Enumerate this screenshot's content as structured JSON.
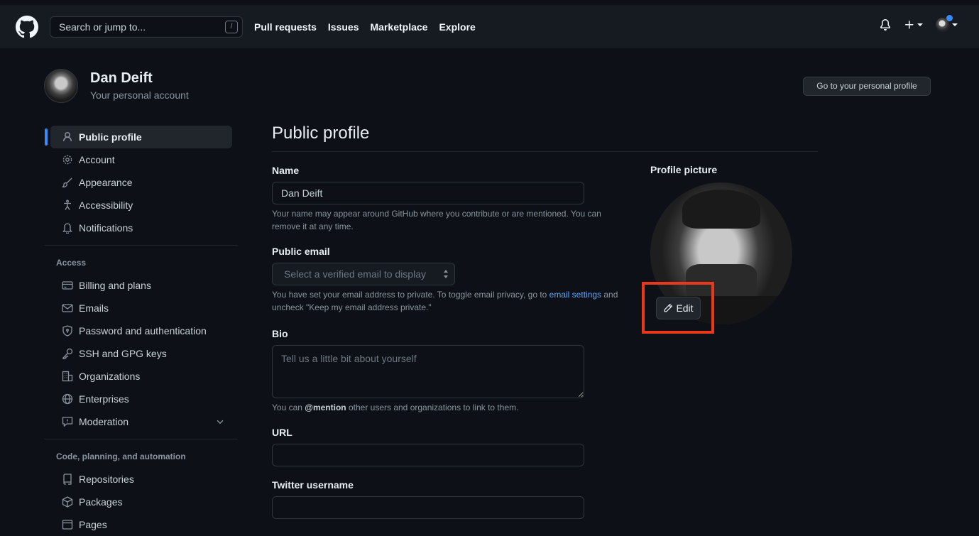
{
  "header": {
    "search_placeholder": "Search or jump to...",
    "search_shortcut": "/",
    "nav": [
      "Pull requests",
      "Issues",
      "Marketplace",
      "Explore"
    ],
    "icons": [
      "github-logo-icon",
      "bell-icon",
      "plus-icon",
      "avatar"
    ]
  },
  "account": {
    "name": "Dan Deift",
    "subtitle": "Your personal account",
    "profile_button": "Go to your personal profile"
  },
  "sidebar": {
    "items_top": [
      {
        "label": "Public profile",
        "icon": "person-icon",
        "active": true
      },
      {
        "label": "Account",
        "icon": "gear-icon"
      },
      {
        "label": "Appearance",
        "icon": "paintbrush-icon"
      },
      {
        "label": "Accessibility",
        "icon": "accessibility-icon"
      },
      {
        "label": "Notifications",
        "icon": "bell-icon"
      }
    ],
    "group_access": "Access",
    "items_access": [
      {
        "label": "Billing and plans",
        "icon": "credit-card-icon"
      },
      {
        "label": "Emails",
        "icon": "mail-icon"
      },
      {
        "label": "Password and authentication",
        "icon": "shield-lock-icon"
      },
      {
        "label": "SSH and GPG keys",
        "icon": "key-icon"
      },
      {
        "label": "Organizations",
        "icon": "organization-icon"
      },
      {
        "label": "Enterprises",
        "icon": "globe-icon"
      },
      {
        "label": "Moderation",
        "icon": "report-icon"
      }
    ],
    "group_code": "Code, planning, and automation",
    "items_code": [
      {
        "label": "Repositories",
        "icon": "repo-icon"
      },
      {
        "label": "Packages",
        "icon": "package-icon"
      },
      {
        "label": "Pages",
        "icon": "browser-icon"
      }
    ]
  },
  "main": {
    "title": "Public profile",
    "name_label": "Name",
    "name_value": "Dan Deift",
    "name_note": "Your name may appear around GitHub where you contribute or are mentioned. You can remove it at any time.",
    "email_label": "Public email",
    "email_placeholder": "Select a verified email to display",
    "email_note_pre": "You have set your email address to private. To toggle email privacy, go to ",
    "email_note_link": "email settings",
    "email_note_post": " and uncheck \"Keep my email address private.\"",
    "bio_label": "Bio",
    "bio_placeholder": "Tell us a little bit about yourself",
    "bio_note_pre": "You can ",
    "bio_note_mention": "@mention",
    "bio_note_post": " other users and organizations to link to them.",
    "url_label": "URL",
    "twitter_label": "Twitter username"
  },
  "picture": {
    "label": "Profile picture",
    "edit_label": "Edit",
    "highlight_color": "#e8391d"
  },
  "colors": {
    "background": "#0d1117",
    "header": "#161b22",
    "accent": "#388bfd",
    "link": "#58a6ff"
  }
}
